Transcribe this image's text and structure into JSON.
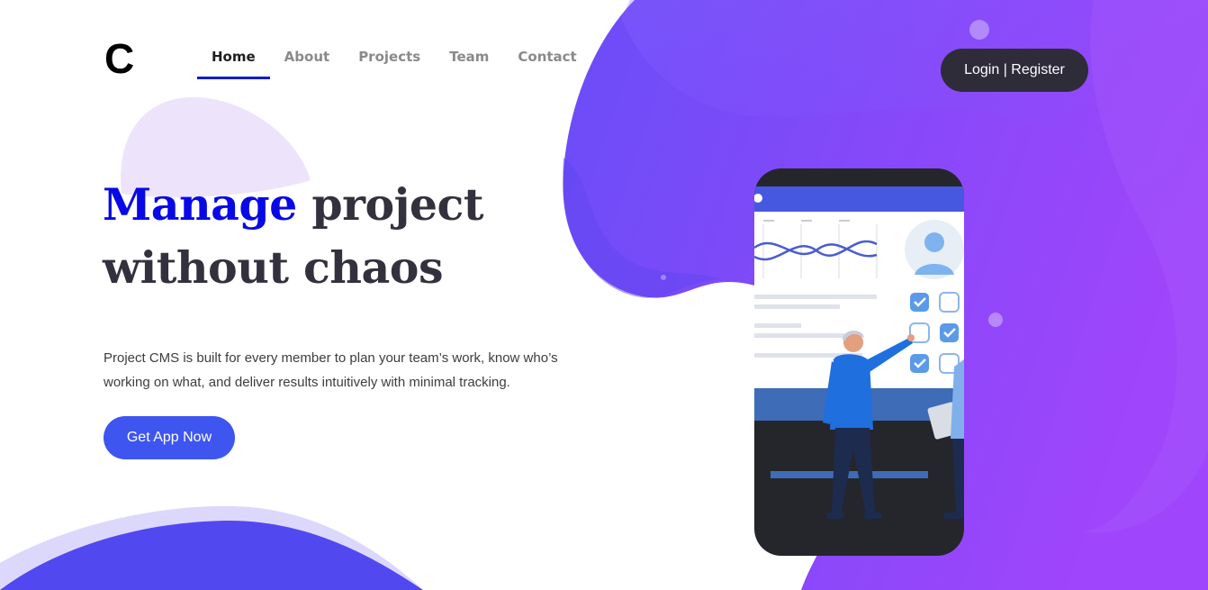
{
  "logo": {
    "letter": "C"
  },
  "nav": {
    "items": [
      {
        "label": "Home",
        "active": true
      },
      {
        "label": "About",
        "active": false
      },
      {
        "label": "Projects",
        "active": false
      },
      {
        "label": "Team",
        "active": false
      },
      {
        "label": "Contact",
        "active": false
      }
    ]
  },
  "auth": {
    "label": "Login | Register"
  },
  "hero": {
    "headline_accent": "Manage",
    "headline_rest_1": " project",
    "headline_line_2": "without chaos",
    "description": "Project CMS is built for every member to plan your team’s work, know who’s working on what, and deliver results intuitively with minimal tracking.",
    "cta_label": "Get App Now"
  },
  "colors": {
    "accent": "#0909e6",
    "primary_button": "#3e55ef",
    "dark_button": "#2f2c3a",
    "nav_underline": "#0f1ccc",
    "blob_start": "#6a4df7",
    "blob_end": "#9f45fb"
  },
  "illustration": {
    "icons": [
      "avatar-icon",
      "checkbox-checked-icon",
      "checkbox-empty-icon",
      "wave-chart-icon",
      "presenter-figure"
    ]
  }
}
